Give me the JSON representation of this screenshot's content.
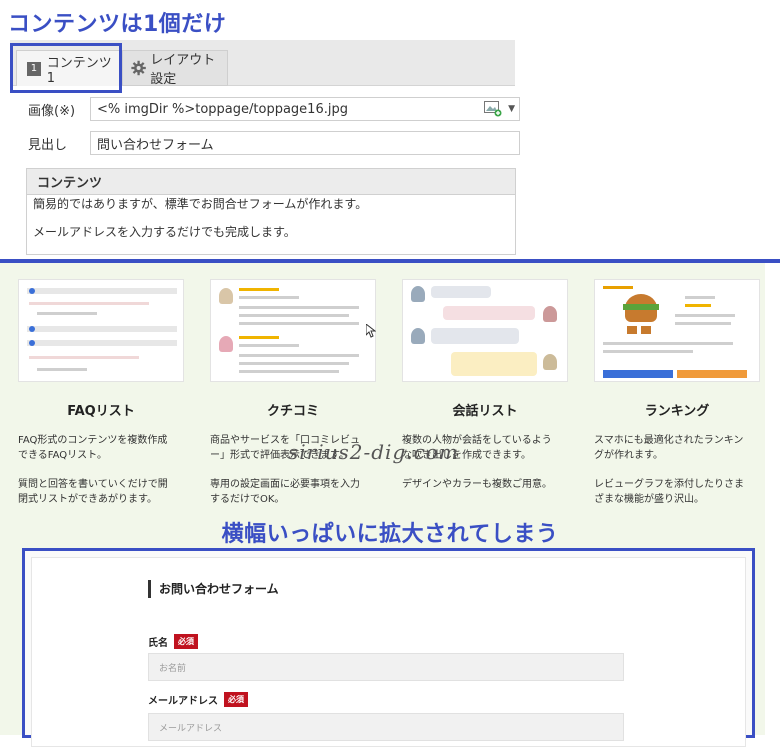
{
  "annotation_top": "コンテンツは1個だけ",
  "annotation_mid": "横幅いっぱいに拡大されてしまう",
  "watermark": "sirius2-dig.com",
  "editor": {
    "tabs": [
      {
        "num": "1",
        "label": "コンテンツ1"
      },
      {
        "label": "レイアウト設定"
      }
    ],
    "image_label": "画像(※)",
    "image_value": "<% imgDir %>toppage/toppage16.jpg",
    "heading_label": "見出し",
    "heading_value": "問い合わせフォーム",
    "content_label": "コンテンツ",
    "content_lines": [
      "簡易的ではありますが、標準でお問合せフォームが作れます。",
      "メールアドレスを入力するだけでも完成します。"
    ]
  },
  "cards": [
    {
      "title": "FAQリスト",
      "desc1": "FAQ形式のコンテンツを複数作成できるFAQリスト。",
      "desc2": "質問と回答を書いていくだけで開閉式リストができあがります。"
    },
    {
      "title": "クチコミ",
      "desc1": "商品やサービスを「口コミレビュー」形式で評価表示できます。",
      "desc2": "専用の設定画面に必要事項を入力するだけでOK。"
    },
    {
      "title": "会話リスト",
      "desc1": "複数の人物が会話をしているような吹き出しを作成できます。",
      "desc2": "デザインやカラーも複数ご用意。"
    },
    {
      "title": "ランキング",
      "desc1": "スマホにも最適化されたランキングが作れます。",
      "desc2": "レビューグラフを添付したりさまざまな機能が盛り沢山。"
    }
  ],
  "form_preview": {
    "heading": "お問い合わせフォーム",
    "name_label": "氏名",
    "name_placeholder": "お名前",
    "email_label": "メールアドレス",
    "email_placeholder": "メールアドレス",
    "required": "必須"
  },
  "colors": {
    "annotation": "#3a4fc4",
    "required_badge": "#c0121f",
    "section_bg": "#f2f7ea"
  }
}
